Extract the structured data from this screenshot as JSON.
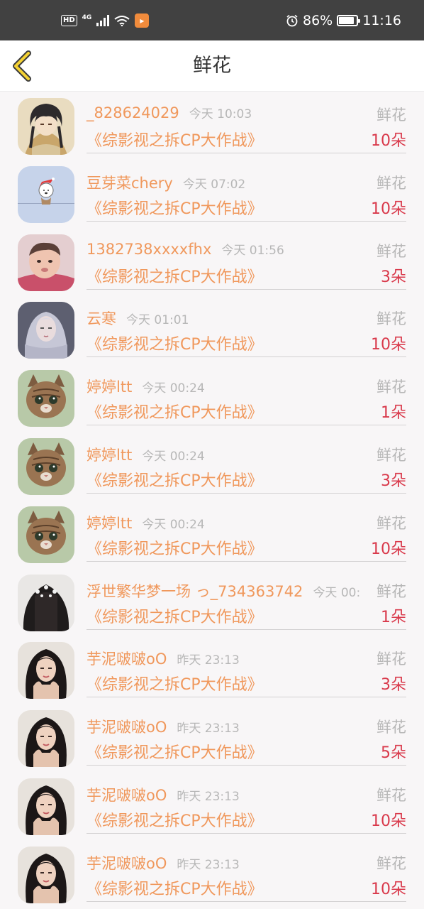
{
  "status_bar": {
    "hd": "HD",
    "network": "4G",
    "battery_text": "86%",
    "battery_level": 0.86,
    "time": "11:16"
  },
  "header": {
    "title": "鲜花"
  },
  "items": [
    {
      "username": "_828624029",
      "time": "今天 10:03",
      "type": "鲜花",
      "title": "《综影视之拆CP大作战》",
      "count": "10朵",
      "avatar": "anime-boy"
    },
    {
      "username": "豆芽菜chery",
      "time": "今天 07:02",
      "type": "鲜花",
      "title": "《综影视之拆CP大作战》",
      "count": "10朵",
      "avatar": "cartoon-dog"
    },
    {
      "username": "1382738xxxxfhx",
      "time": "今天 01:56",
      "type": "鲜花",
      "title": "《综影视之拆CP大作战》",
      "count": "3朵",
      "avatar": "baby"
    },
    {
      "username": "云寒",
      "time": "今天 01:01",
      "type": "鲜花",
      "title": "《综影视之拆CP大作战》",
      "count": "10朵",
      "avatar": "fantasy-girl"
    },
    {
      "username": "婷婷ltt",
      "time": "今天 00:24",
      "type": "鲜花",
      "title": "《综影视之拆CP大作战》",
      "count": "1朵",
      "avatar": "kitten"
    },
    {
      "username": "婷婷ltt",
      "time": "今天 00:24",
      "type": "鲜花",
      "title": "《综影视之拆CP大作战》",
      "count": "3朵",
      "avatar": "kitten"
    },
    {
      "username": "婷婷ltt",
      "time": "今天 00:24",
      "type": "鲜花",
      "title": "《综影视之拆CP大作战》",
      "count": "10朵",
      "avatar": "kitten"
    },
    {
      "username": "浮世繁华梦一场 っ_734363742",
      "time": "今天 00:",
      "type": "鲜花",
      "title": "《综影视之拆CP大作战》",
      "count": "1朵",
      "avatar": "hair-back"
    },
    {
      "username": "芋泥啵啵oO",
      "time": "昨天 23:13",
      "type": "鲜花",
      "title": "《综影视之拆CP大作战》",
      "count": "3朵",
      "avatar": "woman-portrait"
    },
    {
      "username": "芋泥啵啵oO",
      "time": "昨天 23:13",
      "type": "鲜花",
      "title": "《综影视之拆CP大作战》",
      "count": "5朵",
      "avatar": "woman-portrait"
    },
    {
      "username": "芋泥啵啵oO",
      "time": "昨天 23:13",
      "type": "鲜花",
      "title": "《综影视之拆CP大作战》",
      "count": "10朵",
      "avatar": "woman-portrait"
    },
    {
      "username": "芋泥啵啵oO",
      "time": "昨天 23:13",
      "type": "鲜花",
      "title": "《综影视之拆CP大作战》",
      "count": "10朵",
      "avatar": "woman-portrait"
    }
  ]
}
